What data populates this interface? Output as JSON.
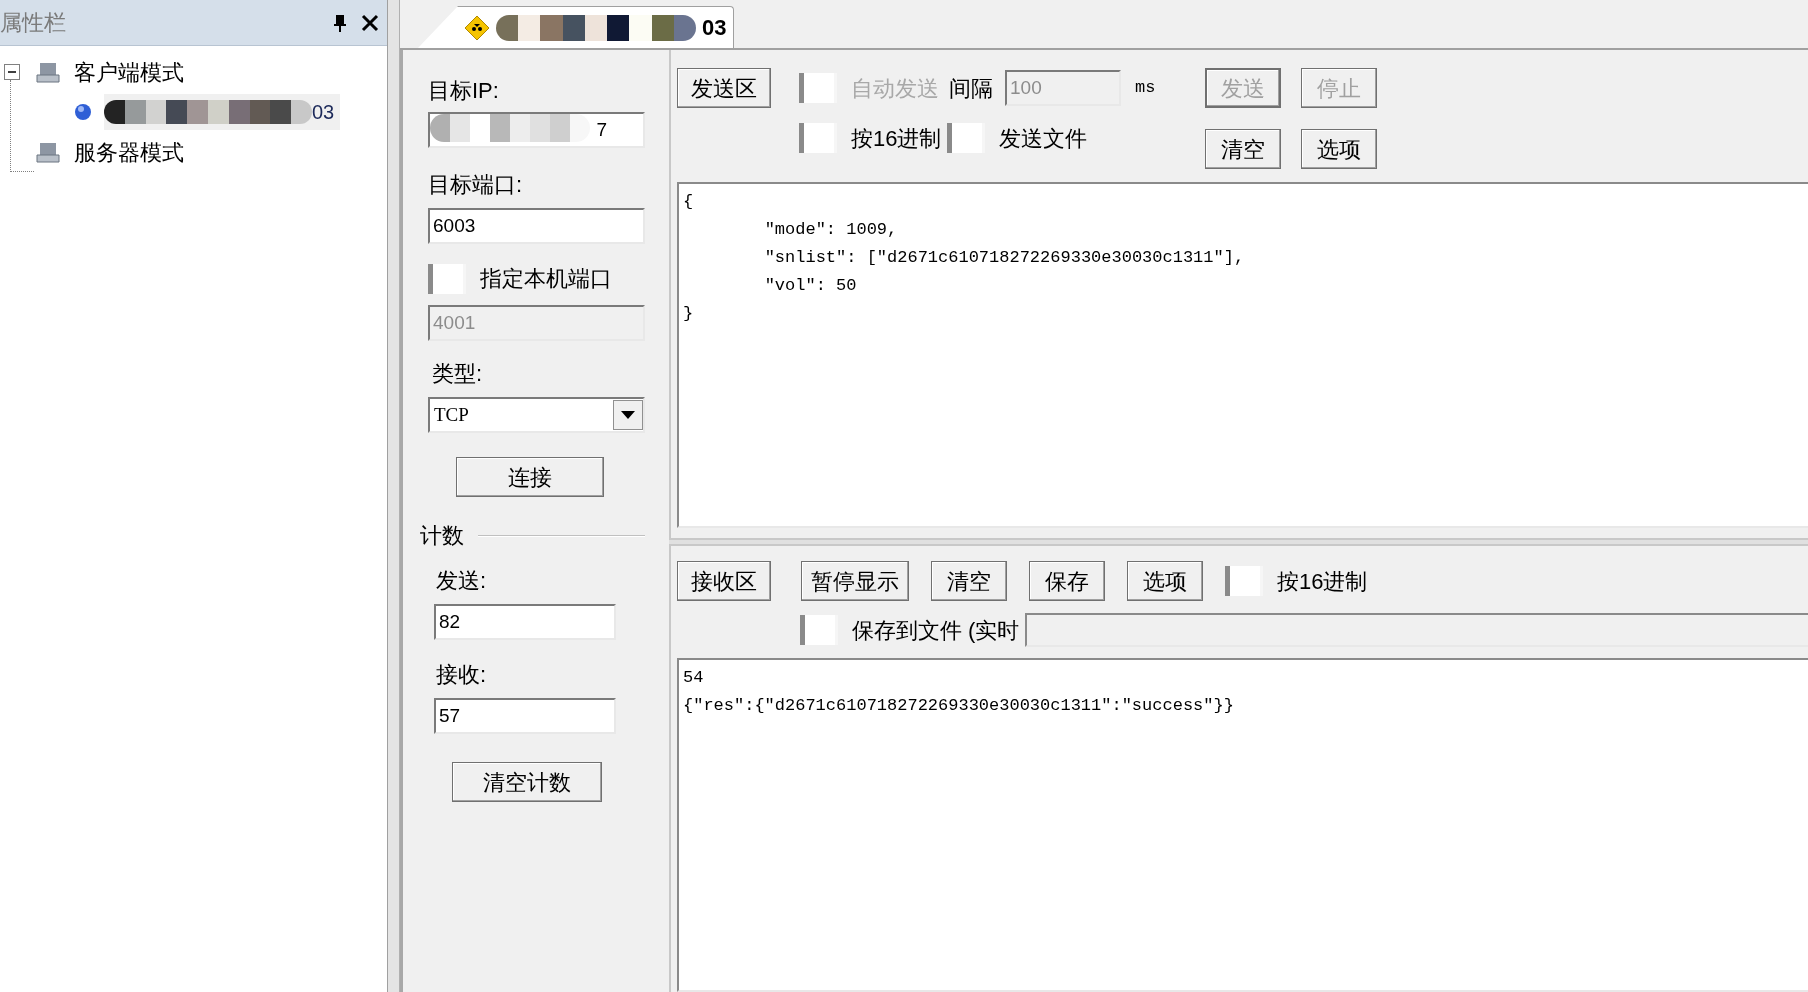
{
  "sidebar": {
    "title": "属性栏",
    "tree": [
      {
        "label": "客户端模式",
        "expanded": true,
        "children": [
          {
            "label": "03"
          }
        ]
      },
      {
        "label": "服务器模式"
      }
    ]
  },
  "tab": {
    "title": "03"
  },
  "connection": {
    "target_ip": {
      "label": "目标IP:",
      "value": "7"
    },
    "target_port": {
      "label": "目标端口:",
      "value": "6003"
    },
    "local_port": {
      "label": "指定本机端口",
      "checked": false,
      "value": "4001",
      "disabled": true
    },
    "type": {
      "label": "类型:",
      "value": "TCP"
    },
    "connect_button": "连接"
  },
  "counter": {
    "title": "计数",
    "sent_label": "发送:",
    "sent": "82",
    "received_label": "接收:",
    "received": "57",
    "clear_button": "清空计数"
  },
  "send": {
    "area_button": "发送区",
    "auto_send": {
      "label": "自动发送",
      "checked": false,
      "disabled": true
    },
    "interval_label": "间隔",
    "interval": {
      "value": "100",
      "disabled": true
    },
    "unit": "ms",
    "hex": {
      "label": "按16进制",
      "checked": false
    },
    "file": {
      "label": "发送文件",
      "checked": false
    },
    "buttons": [
      {
        "label": "发送",
        "disabled": true
      },
      {
        "label": "停止",
        "disabled": true
      },
      {
        "label": "清空",
        "disabled": false
      },
      {
        "label": "选项",
        "disabled": false
      }
    ],
    "text": [
      "{",
      "\t\"mode\": 1009,",
      "\t\"snlist\": [\"d2671c610718272269330e30030c1311\"],",
      "\t\"vol\": 50",
      "}"
    ]
  },
  "receive": {
    "area_button": "接收区",
    "buttons": [
      "暂停显示",
      "清空",
      "保存",
      "选项"
    ],
    "hex": {
      "label": "按16进制",
      "checked": false
    },
    "save_file": {
      "label": "保存到文件 (实时",
      "checked": false
    },
    "text": [
      "54",
      "{\"res\":{\"d2671c610718272269330e30030c1311\":\"success\"}}"
    ]
  }
}
